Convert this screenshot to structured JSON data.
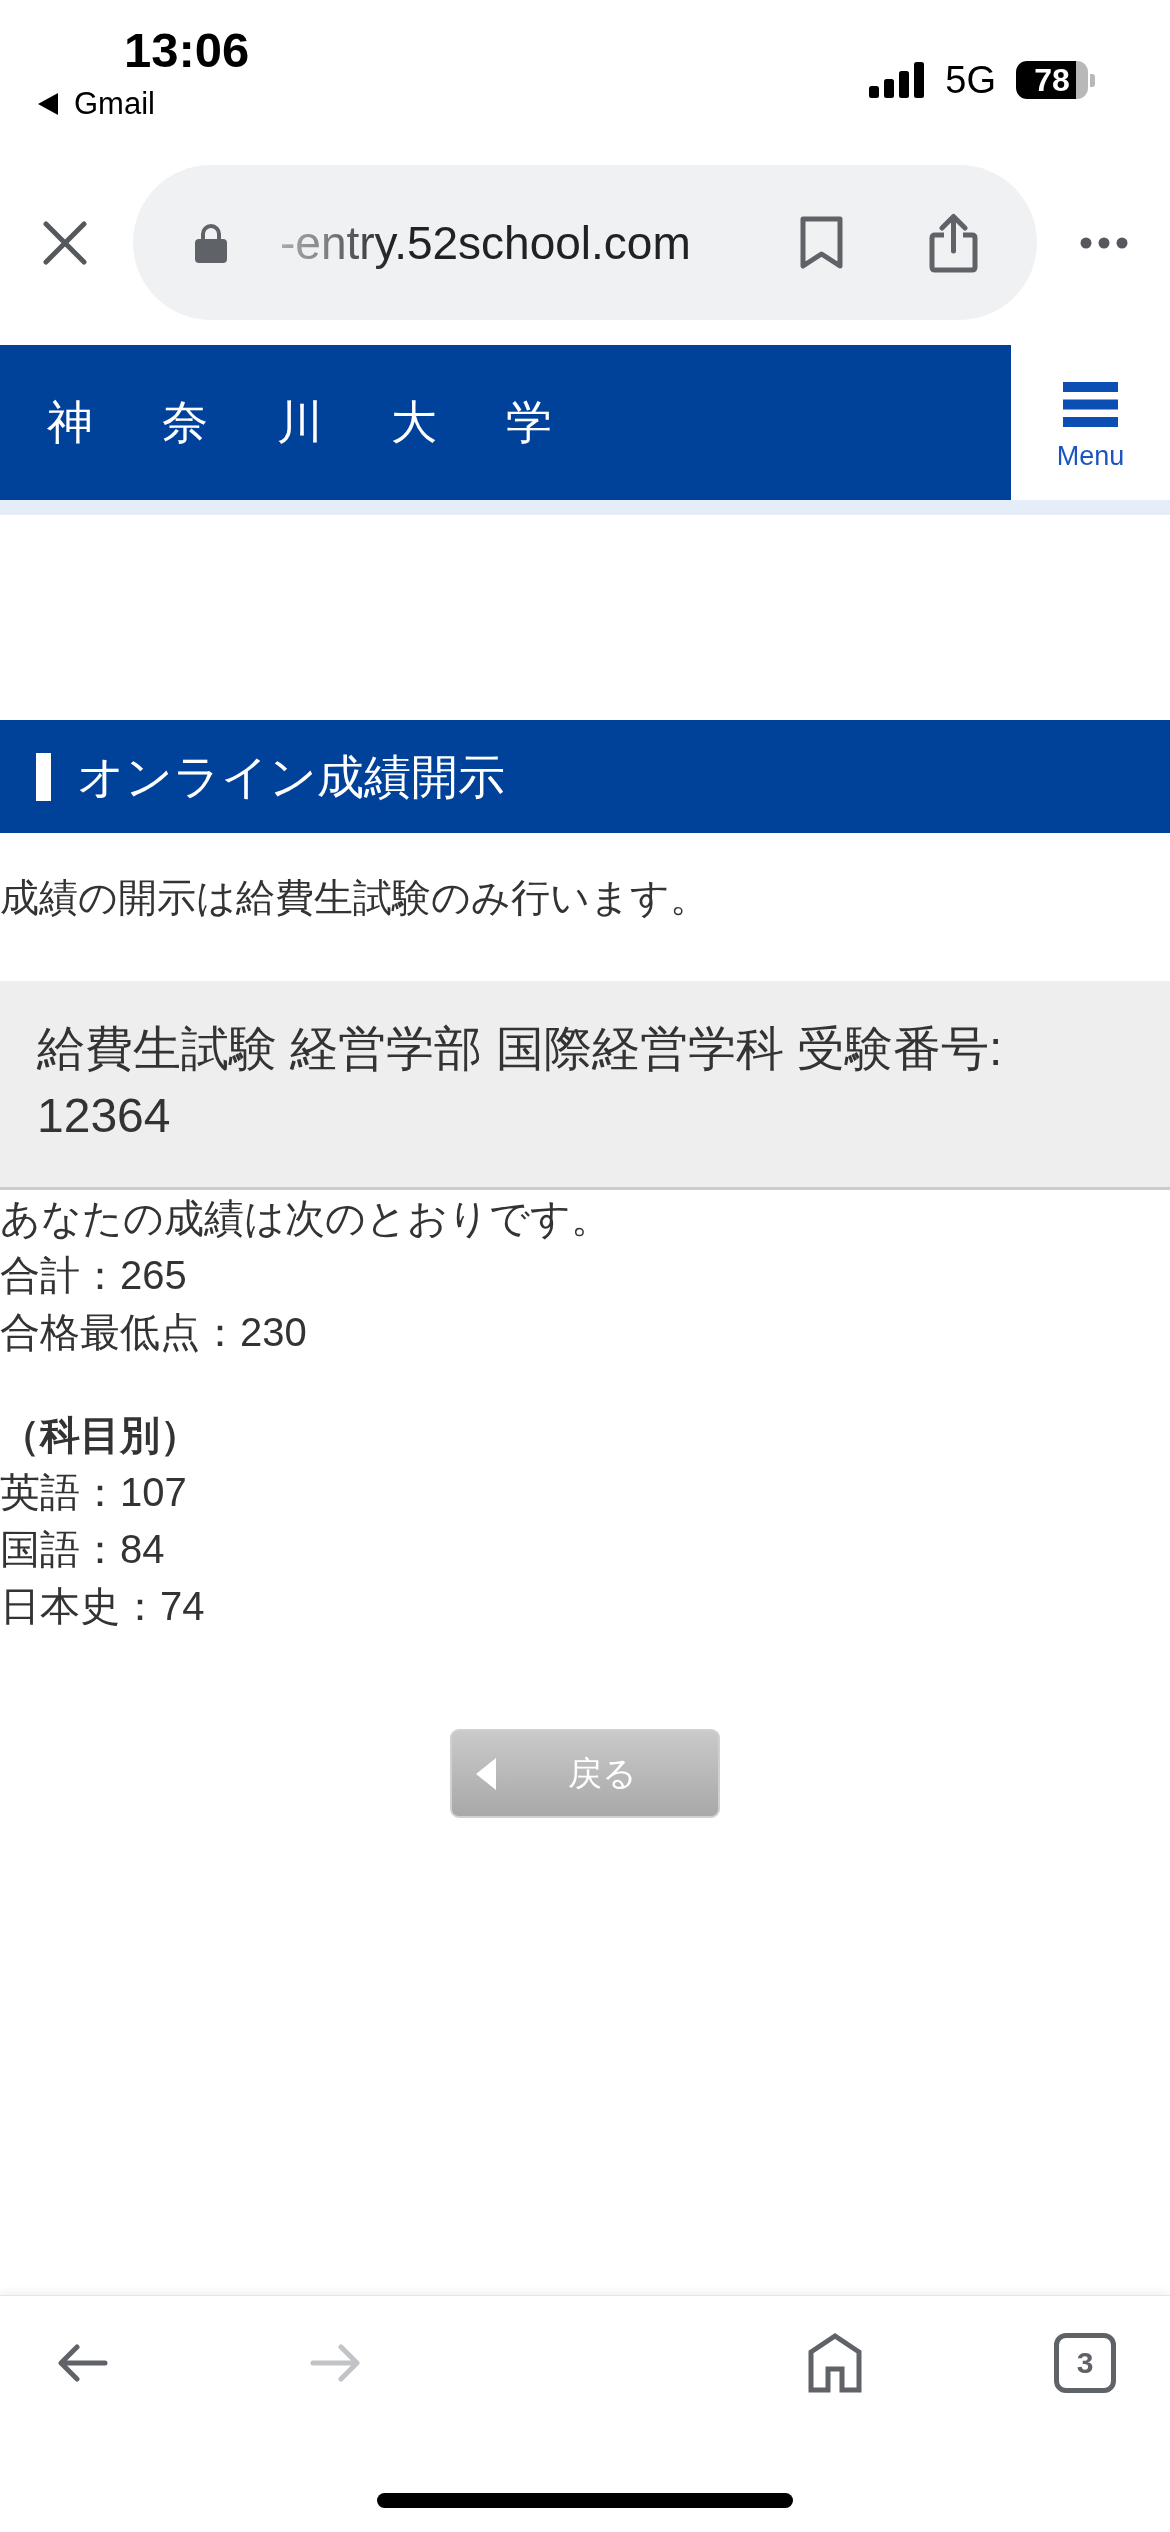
{
  "status_bar": {
    "time": "13:06",
    "back_app": "Gmail",
    "network": "5G",
    "battery": "78"
  },
  "browser": {
    "url": "-entry.52school.com",
    "toolbar": [
      {
        "kind": "back",
        "disabled": false
      },
      {
        "kind": "forward",
        "disabled": true
      },
      {
        "kind": "home",
        "disabled": false
      },
      {
        "kind": "tabs",
        "label": "3",
        "disabled": false
      }
    ]
  },
  "site_header": {
    "title": "神 奈 川 大 学",
    "menu_label": "Menu"
  },
  "page": {
    "section_title": "オンライン成績開示",
    "notice": "成績の開示は給費生試験のみ行います。",
    "exam_info": "給費生試験 経営学部 国際経営学科 受験番号: 12364",
    "intro": "あなたの成績は次のとおりです。",
    "totals": [
      "合計：265",
      "合格最低点：230"
    ],
    "subject_heading": "（科目別）",
    "subjects": [
      "英語：107",
      "国語：84",
      "日本史：74"
    ]
  },
  "back_button": {
    "label": "戻る"
  }
}
